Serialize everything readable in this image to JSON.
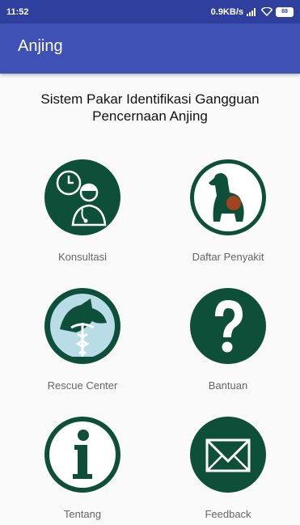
{
  "status_bar": {
    "time": "11:52",
    "network_speed": "0.9KB/s",
    "battery": "88"
  },
  "app_bar": {
    "title": "Anjing"
  },
  "heading": {
    "line1": "Sistem Pakar Identifikasi Gangguan",
    "line2": "Pencernaan Anjing"
  },
  "menu": {
    "konsultasi": {
      "label": "Konsultasi",
      "icon": "doctor-clock-icon"
    },
    "daftar_penyakit": {
      "label": "Daftar Penyakit",
      "icon": "sick-dog-icon"
    },
    "rescue_center": {
      "label": "Rescue Center",
      "icon": "vet-caduceus-icon"
    },
    "bantuan": {
      "label": "Bantuan",
      "icon": "question-mark-icon"
    },
    "tentang": {
      "label": "Tentang",
      "icon": "info-icon"
    },
    "feedback": {
      "label": "Feedback",
      "icon": "mail-icon"
    }
  },
  "colors": {
    "primary": "#3f51b5",
    "primary_dark": "#2e3f9e",
    "icon_green": "#0e4f3a"
  }
}
